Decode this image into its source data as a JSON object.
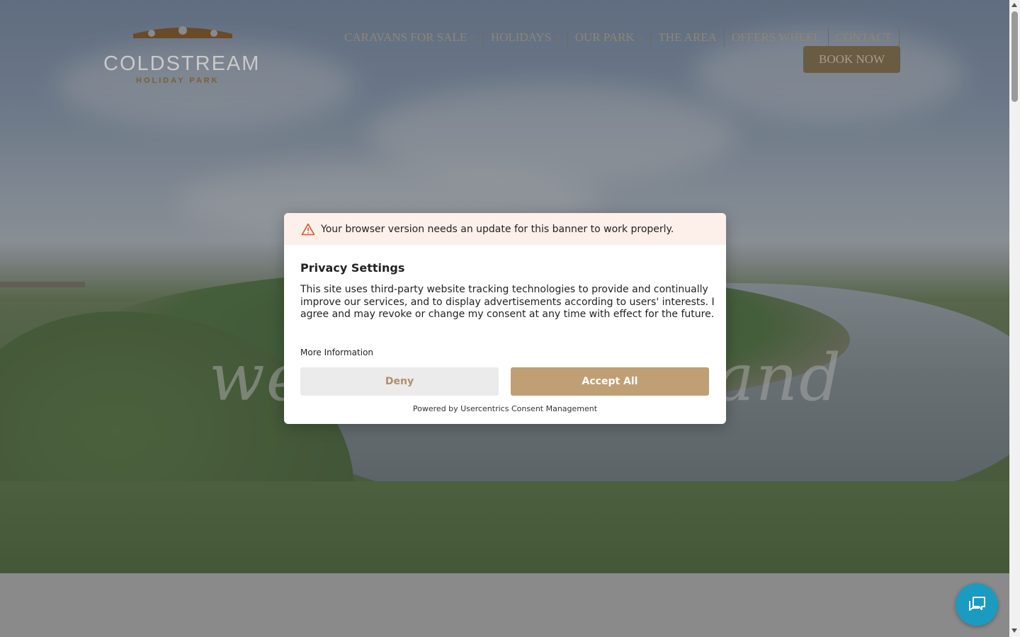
{
  "brand": {
    "name": "COLDSTREAM",
    "subtitle": "HOLIDAY PARK"
  },
  "nav": {
    "items": [
      {
        "label": "CARAVANS FOR SALE",
        "has_dropdown": true
      },
      {
        "label": "HOLIDAYS",
        "has_dropdown": true
      },
      {
        "label": "OUR PARK",
        "has_dropdown": true
      },
      {
        "label": "THE AREA",
        "has_dropdown": false
      },
      {
        "label": "OFFERS WHEEL",
        "has_dropdown": false
      },
      {
        "label": "CONTACT",
        "has_dropdown": false
      }
    ],
    "caret_glyph": "▯",
    "book_label": "BOOK NOW"
  },
  "hero": {
    "script_left": "wel",
    "script_right": "and"
  },
  "consent": {
    "warning": "Your browser version needs an update for this banner to work properly.",
    "title": "Privacy Settings",
    "description": "This site uses third-party website tracking technologies to provide and continually improve our services, and to display advertisements according to users' interests. I agree and may revoke or change my consent at any time with effect for the future.",
    "more_info": "More Information",
    "deny_label": "Deny",
    "accept_label": "Accept All",
    "powered_by": "Powered by Usercentrics Consent Management"
  },
  "colors": {
    "accent": "#c09f74",
    "chat": "#1b9bc1",
    "warning_bg": "#fdf0ea"
  },
  "icons": {
    "warning": "warning-triangle-icon",
    "chat": "chat-bubbles-icon",
    "logo": "bridge-arches-logo"
  }
}
